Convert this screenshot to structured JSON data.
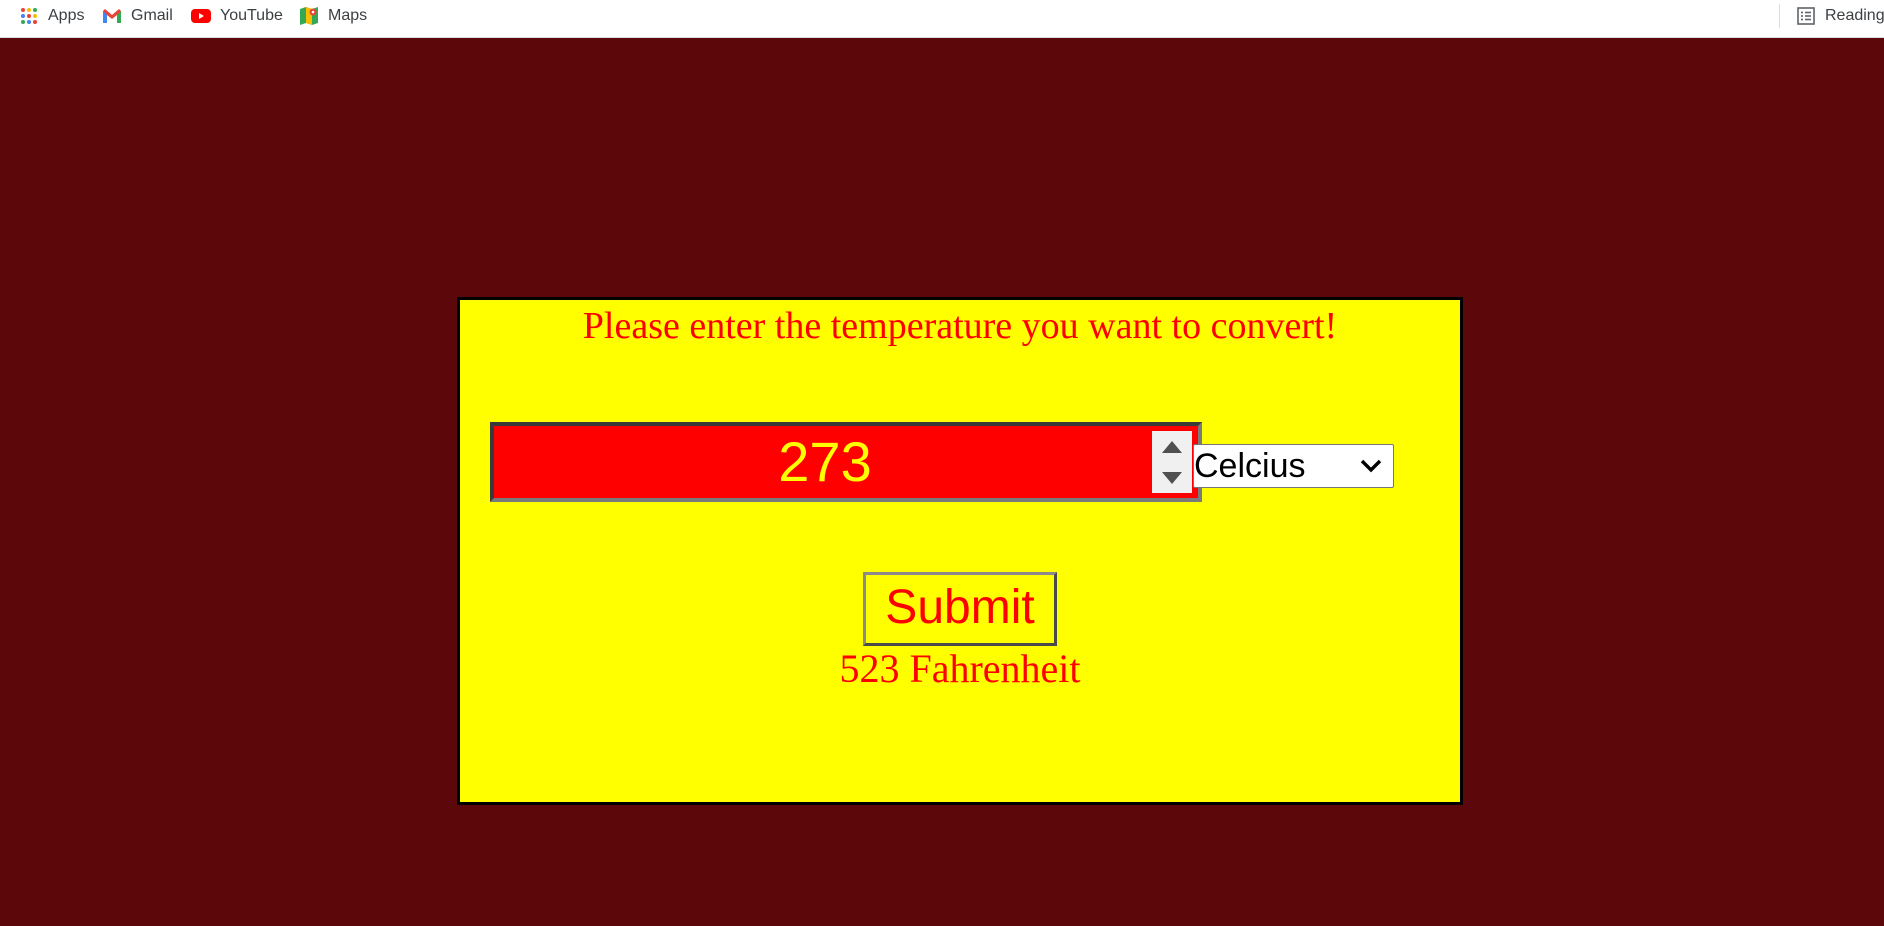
{
  "bookmarks": {
    "apps_label": "Apps",
    "gmail_label": "Gmail",
    "youtube_label": "YouTube",
    "maps_label": "Maps",
    "reading_label": "Reading"
  },
  "converter": {
    "heading": "Please enter the temperature you want to convert!",
    "input_value": "273",
    "unit_selected": "Celcius",
    "submit_label": "Submit",
    "result_text": "523 Fahrenheit"
  },
  "colors": {
    "page_background": "#5c080b",
    "panel_background": "#ffff00",
    "accent_text": "#ff0000",
    "input_background": "#ff0000",
    "input_text": "#ffff00"
  },
  "icons": {
    "apps": "apps-grid-icon",
    "gmail": "gmail-icon",
    "youtube": "youtube-icon",
    "maps": "maps-icon",
    "reading": "reading-list-icon",
    "spin_up": "spin-up-icon",
    "spin_down": "spin-down-icon",
    "select": "chevron-down-icon"
  }
}
